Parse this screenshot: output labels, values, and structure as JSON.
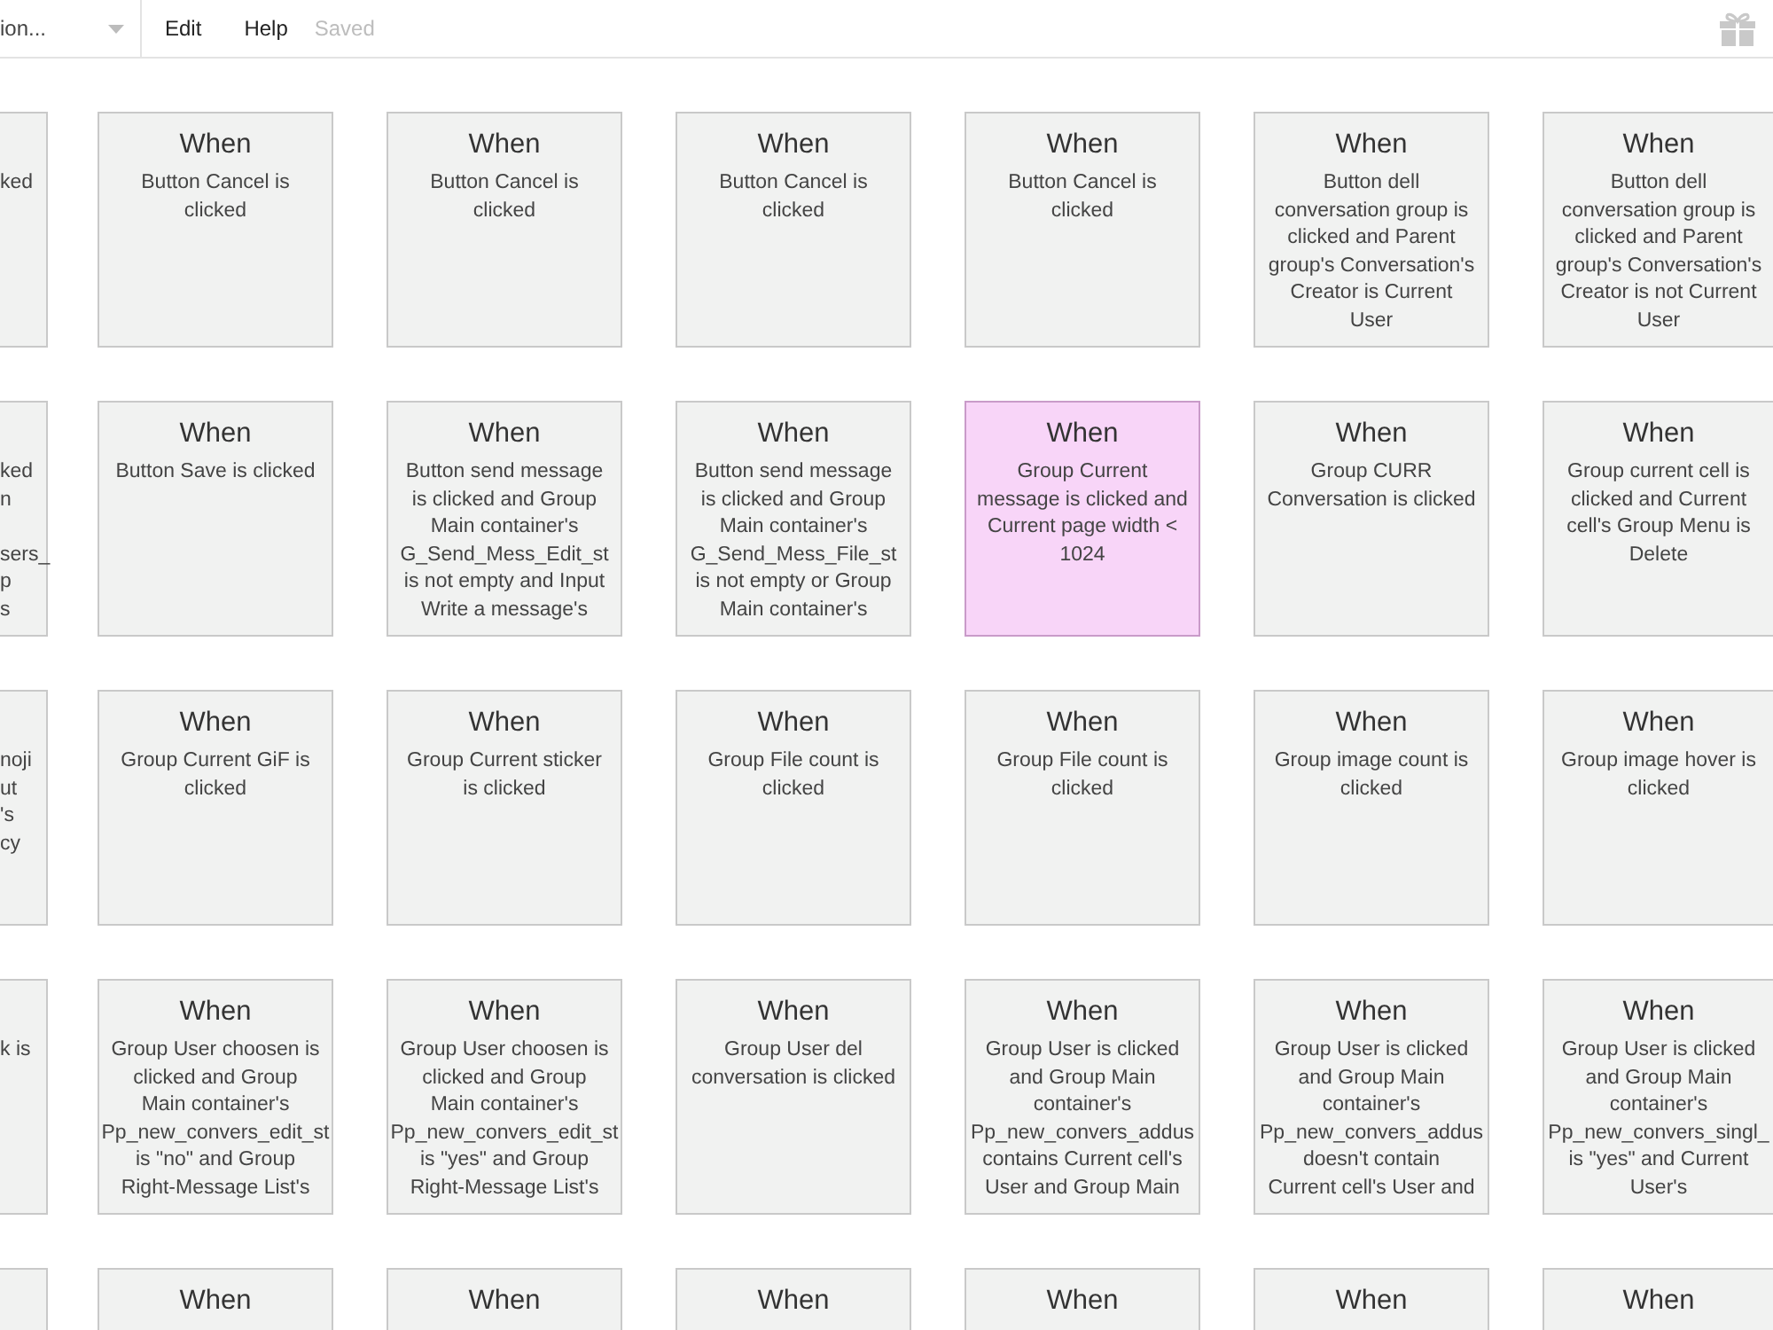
{
  "toolbar": {
    "page_selector": {
      "value": "ion..."
    },
    "menu": [
      "Edit",
      "Help"
    ],
    "status": "Saved"
  },
  "grid": {
    "rows": [
      {
        "kind": "full",
        "cards": [
          {
            "kind": "left-edge",
            "selected": false,
            "condition": "ked"
          },
          {
            "kind": "card",
            "selected": false,
            "title": "When",
            "condition": "Button Cancel is\nclicked"
          },
          {
            "kind": "card",
            "selected": false,
            "title": "When",
            "condition": "Button Cancel is\nclicked"
          },
          {
            "kind": "card",
            "selected": false,
            "title": "When",
            "condition": "Button Cancel is\nclicked"
          },
          {
            "kind": "card",
            "selected": false,
            "title": "When",
            "condition": "Button Cancel is\nclicked"
          },
          {
            "kind": "card",
            "selected": false,
            "title": "When",
            "condition": "Button dell\nconversation group is\nclicked and Parent\ngroup's Conversation's\nCreator is Current\nUser"
          },
          {
            "kind": "right-edge",
            "selected": false,
            "title": "When",
            "condition": "Button dell\nconversation group is\nclicked and Parent\ngroup's Conversation's\nCreator is not Current\nUser"
          }
        ]
      },
      {
        "kind": "full",
        "cards": [
          {
            "kind": "left-edge",
            "selected": false,
            "condition": "ked\nn\n\nsers_\np\ns"
          },
          {
            "kind": "card",
            "selected": false,
            "title": "When",
            "condition": "Button Save is clicked"
          },
          {
            "kind": "card",
            "selected": false,
            "title": "When",
            "condition": "Button send message\nis clicked and Group\nMain container's\nG_Send_Mess_Edit_st\nis not empty and Input\nWrite a message's"
          },
          {
            "kind": "card",
            "selected": false,
            "title": "When",
            "condition": "Button send message\nis clicked and Group\nMain container's\nG_Send_Mess_File_st\nis not empty or Group\nMain container's"
          },
          {
            "kind": "card",
            "selected": true,
            "title": "When",
            "condition": "Group Current\nmessage is clicked and\nCurrent page width <\n1024"
          },
          {
            "kind": "card",
            "selected": false,
            "title": "When",
            "condition": "Group CURR\nConversation is clicked"
          },
          {
            "kind": "right-edge",
            "selected": false,
            "title": "When",
            "condition": "Group current cell is\nclicked and Current\ncell's Group Menu is\nDelete"
          }
        ]
      },
      {
        "kind": "full",
        "cards": [
          {
            "kind": "left-edge",
            "selected": false,
            "condition": "noji\nut\n's\ncy"
          },
          {
            "kind": "card",
            "selected": false,
            "title": "When",
            "condition": "Group Current GiF is\nclicked"
          },
          {
            "kind": "card",
            "selected": false,
            "title": "When",
            "condition": "Group Current sticker\nis clicked"
          },
          {
            "kind": "card",
            "selected": false,
            "title": "When",
            "condition": "Group File count is\nclicked"
          },
          {
            "kind": "card",
            "selected": false,
            "title": "When",
            "condition": "Group File count is\nclicked"
          },
          {
            "kind": "card",
            "selected": false,
            "title": "When",
            "condition": "Group image count is\nclicked"
          },
          {
            "kind": "right-edge",
            "selected": false,
            "title": "When",
            "condition": "Group image hover is\nclicked"
          }
        ]
      },
      {
        "kind": "full",
        "cards": [
          {
            "kind": "left-edge",
            "selected": false,
            "condition": "k is"
          },
          {
            "kind": "card",
            "selected": false,
            "title": "When",
            "condition": "Group User choosen is\nclicked and Group\nMain container's\nPp_new_convers_edit_st\nis \"no\" and Group\nRight-Message List's"
          },
          {
            "kind": "card",
            "selected": false,
            "title": "When",
            "condition": "Group User choosen is\nclicked and Group\nMain container's\nPp_new_convers_edit_st\nis \"yes\" and Group\nRight-Message List's"
          },
          {
            "kind": "card",
            "selected": false,
            "title": "When",
            "condition": "Group User del\nconversation is clicked"
          },
          {
            "kind": "card",
            "selected": false,
            "title": "When",
            "condition": "Group User is clicked\nand Group Main\ncontainer's\nPp_new_convers_addus\ncontains Current cell's\nUser and Group Main"
          },
          {
            "kind": "card",
            "selected": false,
            "title": "When",
            "condition": "Group User is clicked\nand Group Main\ncontainer's\nPp_new_convers_addus\ndoesn't contain\nCurrent cell's User and"
          },
          {
            "kind": "right-edge",
            "selected": false,
            "title": "When",
            "condition": "Group User is clicked\nand Group Main\ncontainer's\nPp_new_convers_singl_\nis \"yes\" and Current\nUser's"
          }
        ]
      },
      {
        "kind": "bottom-edge",
        "cards": [
          {
            "kind": "left-edge",
            "selected": false
          },
          {
            "kind": "card",
            "selected": false,
            "title": "When"
          },
          {
            "kind": "card",
            "selected": false,
            "title": "When"
          },
          {
            "kind": "card",
            "selected": false,
            "title": "When"
          },
          {
            "kind": "card",
            "selected": false,
            "title": "When"
          },
          {
            "kind": "card",
            "selected": false,
            "title": "When"
          },
          {
            "kind": "right-edge",
            "selected": false,
            "title": "When"
          }
        ]
      }
    ]
  }
}
